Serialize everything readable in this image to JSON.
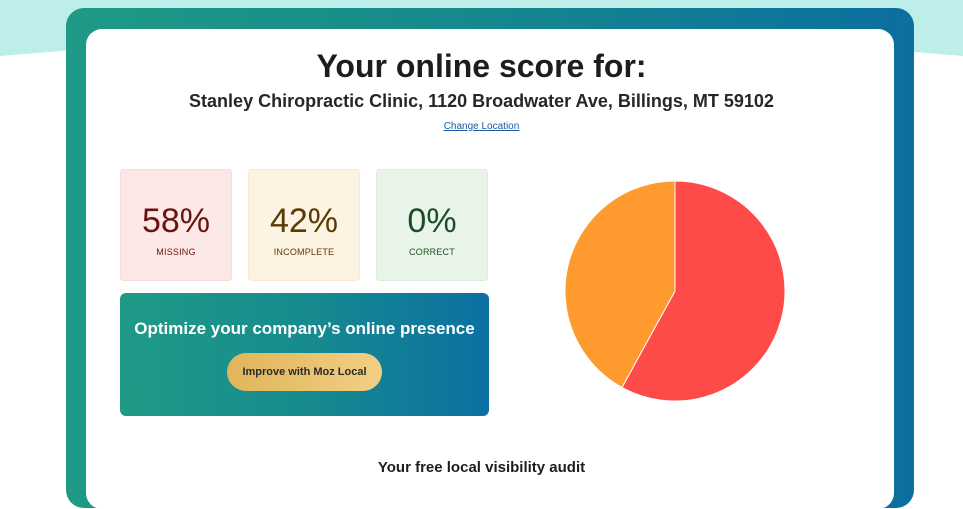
{
  "header": {
    "title": "Your online score for:",
    "business": "Stanley Chiropractic Clinic, 1120 Broadwater Ave, Billings, MT 59102",
    "change_location": "Change Location"
  },
  "stats": [
    {
      "value": "58%",
      "label": "MISSING"
    },
    {
      "value": "42%",
      "label": "INCOMPLETE"
    },
    {
      "value": "0%",
      "label": "CORRECT"
    }
  ],
  "promo": {
    "text": "Optimize your company’s online presence",
    "button_label": "Improve with Moz Local"
  },
  "audit_heading": "Your free local visibility audit",
  "chart_data": {
    "type": "pie",
    "categories": [
      "MISSING",
      "INCOMPLETE",
      "CORRECT"
    ],
    "values": [
      58,
      42,
      0
    ],
    "colors": [
      "#fe4a49",
      "#fe9a2e",
      "#5cb85c"
    ]
  },
  "colors": {
    "accent_teal": "#1f9a86",
    "accent_blue": "#0b6fa0",
    "missing": "#fe4a49",
    "incomplete": "#fe9a2e"
  }
}
